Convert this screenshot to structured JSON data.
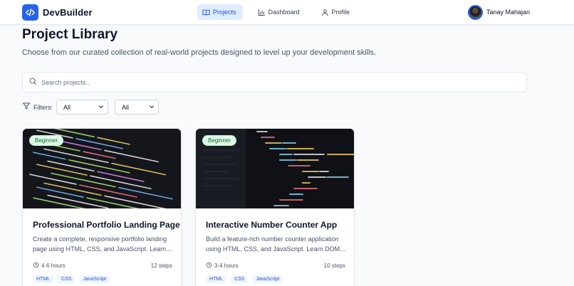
{
  "app": {
    "name": "DevBuilder"
  },
  "nav": {
    "items": [
      {
        "label": "Projects",
        "icon": "book-icon",
        "active": true
      },
      {
        "label": "Dashboard",
        "icon": "bar-chart-icon",
        "active": false
      },
      {
        "label": "Profile",
        "icon": "user-icon",
        "active": false
      }
    ]
  },
  "user": {
    "name": "Tanay Mahajan"
  },
  "page": {
    "title": "Project Library",
    "subtitle": "Choose from our curated collection of real-world projects designed to level up your development skills."
  },
  "search": {
    "placeholder": "Search projects...",
    "value": ""
  },
  "filters": {
    "label": "Filters:",
    "difficulty": {
      "selected": "All"
    },
    "category": {
      "selected": "All"
    }
  },
  "projects": [
    {
      "title": "Professional Portfolio Landing Page",
      "description": "Create a complete, responsive portfolio landing page using HTML, CSS, and JavaScript. Learn...",
      "difficulty": "Beginner",
      "duration": "4-6 hours",
      "steps": "12 steps",
      "tags": [
        "HTML",
        "CSS",
        "JavaScript"
      ]
    },
    {
      "title": "Interactive Number Counter App",
      "description": "Build a feature-rich number counter application using HTML, CSS, and JavaScript. Learn DOM...",
      "difficulty": "Beginner",
      "duration": "3-4 hours",
      "steps": "10 steps",
      "tags": [
        "HTML",
        "CSS",
        "JavaScript"
      ]
    }
  ],
  "colors": {
    "accent": "#2563eb",
    "badge_bg": "#dcfce7",
    "badge_text": "#166534",
    "tag_bg": "#eff6ff",
    "tag_text": "#1d4ed8"
  }
}
